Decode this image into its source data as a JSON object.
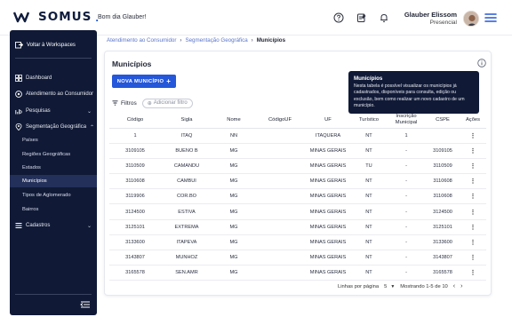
{
  "header": {
    "logo_text": "somus",
    "greeting": "Bom dia Glauber!",
    "user_name": "Glauber Elissom",
    "user_status": "Presencial"
  },
  "sidebar": {
    "back_label": "Voltar à Workspaces",
    "items": [
      {
        "label": "Dashboard",
        "icon": "dashboard-icon"
      },
      {
        "label": "Atendimento ao Consumidor",
        "icon": "headset-icon"
      },
      {
        "label": "Pesquisas",
        "icon": "search-chart-icon"
      },
      {
        "label": "Segmentação Geográfica",
        "icon": "map-pin-icon"
      },
      {
        "label": "Cadastros",
        "icon": "list-icon"
      }
    ],
    "sub_items": [
      "Países",
      "Regiões Geográficas",
      "Estados",
      "Municípios",
      "Tipos de Aglomerado",
      "Bairros"
    ],
    "active_sub_item": "Municípios"
  },
  "breadcrumb": [
    "Atendimento ao Consumidor",
    "Segmentação Geográfica",
    "Municípios"
  ],
  "page": {
    "title": "Municípios",
    "new_button": "NOVA MUNICÍPIO",
    "filters_label": "Filtros",
    "add_filter": "Adicionar filtro"
  },
  "tooltip": {
    "title": "Municípios",
    "text": "Nesta tabela é possível visualizar os municípios já cadastrados, disponíveis para consulta, edição ou exclusão, bem como realizar um novo cadastro de um município."
  },
  "table": {
    "columns": [
      "Código",
      "Sigla",
      "Nome",
      "CódigoUF",
      "UF",
      "Turístico",
      "Inscrição Municipal",
      "CSPE",
      "Ações"
    ],
    "rows": [
      [
        "1",
        "ITAQ",
        "NN",
        "",
        "ITAQUERA",
        "NT",
        "1",
        "",
        "⋮"
      ],
      [
        "3109105",
        "BUENO B",
        "MG",
        "",
        "MINAS GERAIS",
        "NT",
        "-",
        "3109105",
        "⋮"
      ],
      [
        "3110509",
        "CAMANDU",
        "MG",
        "",
        "MINAS GERAIS",
        "TU",
        "-",
        "3110509",
        "⋮"
      ],
      [
        "3110608",
        "CAMBUI",
        "MG",
        "",
        "MINAS GERAIS",
        "NT",
        "-",
        "3110608",
        "⋮"
      ],
      [
        "3119906",
        "COR.BO",
        "MG",
        "",
        "MINAS GERAIS",
        "NT",
        "-",
        "3110608",
        "⋮"
      ],
      [
        "3124500",
        "ESTIVA",
        "MG",
        "",
        "MINAS GERAIS",
        "NT",
        "-",
        "3124500",
        "⋮"
      ],
      [
        "3125101",
        "EXTREMA",
        "MG",
        "",
        "MINAS GERAIS",
        "NT",
        "-",
        "3125101",
        "⋮"
      ],
      [
        "3133600",
        "ITAPEVA",
        "MG",
        "",
        "MINAS GERAIS",
        "NT",
        "-",
        "3133600",
        "⋮"
      ],
      [
        "3143807",
        "MUNHOZ",
        "MG",
        "",
        "MINAS GERAIS",
        "NT",
        "-",
        "3143807",
        "⋮"
      ],
      [
        "3165578",
        "SEN.AMR",
        "MG",
        "",
        "MINAS GERAIS",
        "NT",
        "-",
        "3165578",
        "⋮"
      ]
    ]
  },
  "pagination": {
    "rows_per_page_label": "Linhas por página",
    "rows_per_page": "5",
    "range_text": "Mostrando 1-5 de 10"
  },
  "colors": {
    "sidebar_bg": "#101a36",
    "primary": "#2457d9",
    "breadcrumb_link": "#5b76c9"
  }
}
